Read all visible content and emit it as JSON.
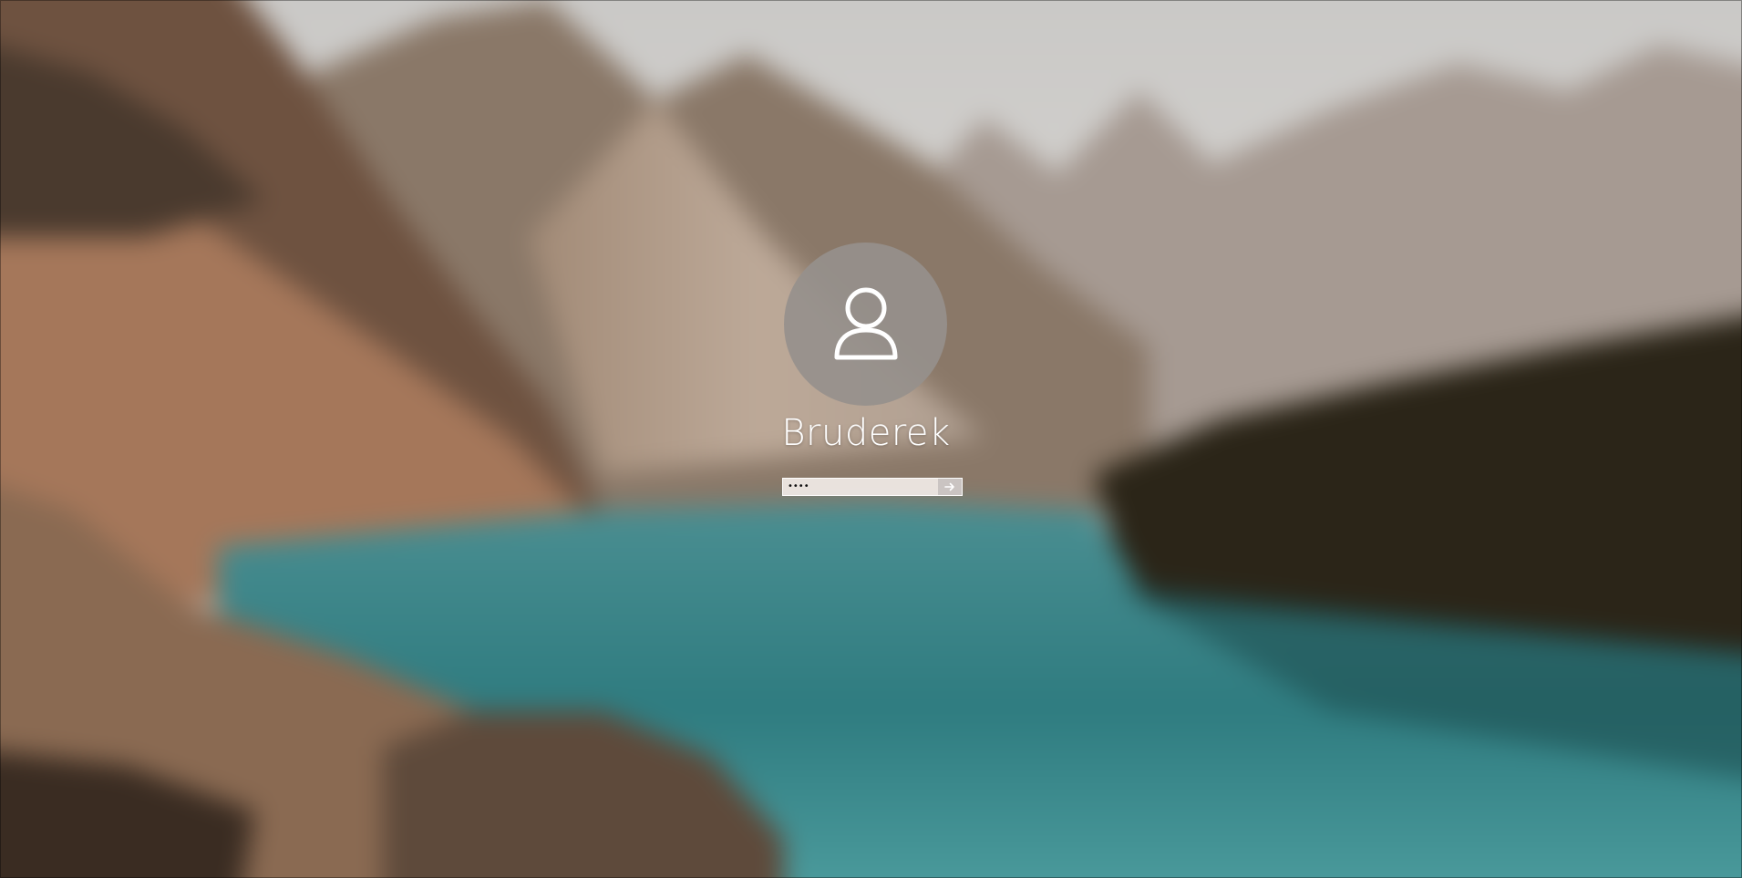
{
  "login": {
    "username": "Bruderek",
    "password_mask": "••••",
    "submit_icon": "arrow-right-icon",
    "avatar_icon": "user-icon"
  },
  "colors": {
    "avatar_bg": "#96908c",
    "field_bg": "#eee8e4",
    "text": "#ffffff"
  }
}
